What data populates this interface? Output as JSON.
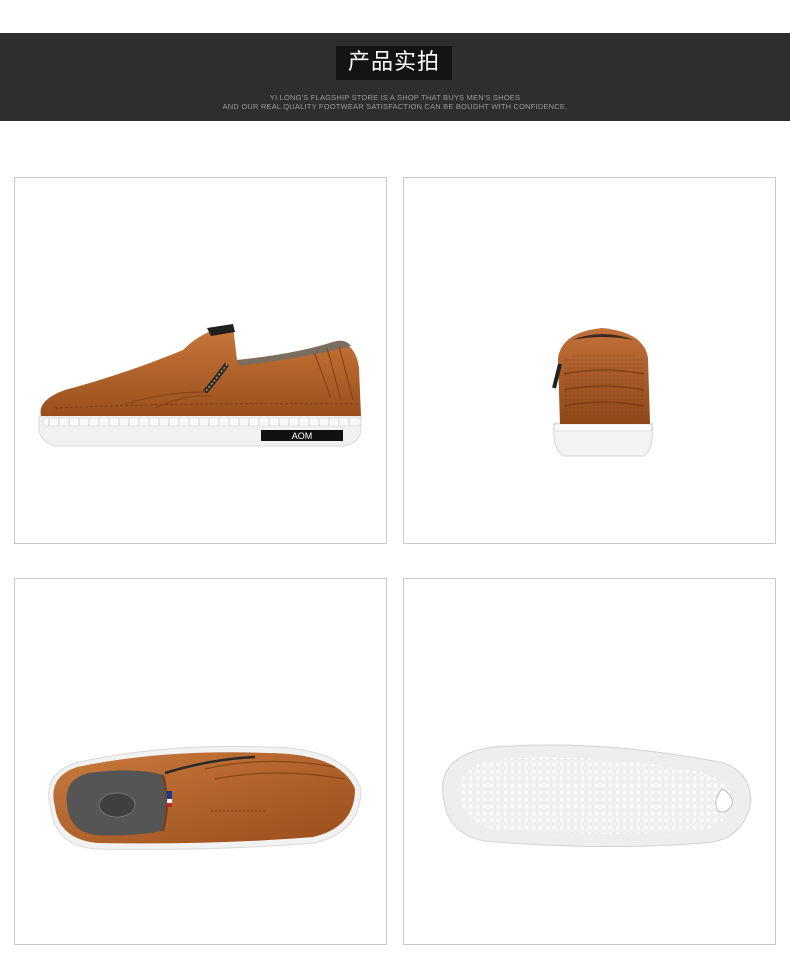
{
  "header": {
    "title": "产品实拍",
    "subtitle_line1": "YI LONG'S FLAGSHIP STORE IS A SHOP THAT BUYS MEN'S SHOES",
    "subtitle_line2": "AND OUR REAL QUALITY FOOTWEAR SATISFACTION CAN BE BOUGHT WITH CONFIDENCE."
  },
  "photos": [
    {
      "view": "side",
      "sole_label": "AOM"
    },
    {
      "view": "back"
    },
    {
      "view": "top"
    },
    {
      "view": "sole"
    }
  ],
  "colors": {
    "banner": "#2e2e2e",
    "title_box": "#141414",
    "leather": "#b8662a",
    "sole": "#f4f4f4"
  }
}
